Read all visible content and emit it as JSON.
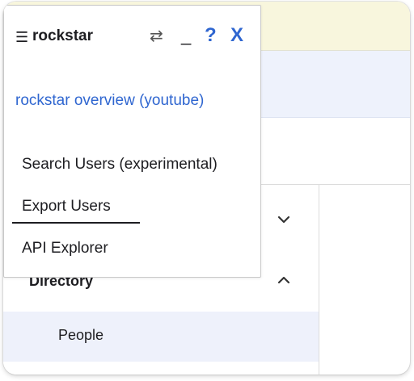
{
  "popup": {
    "menu_icon": "☰",
    "brand": "rockstar",
    "swap_icon": "⇄",
    "minimize_label": "_",
    "help_label": "?",
    "close_label": "X",
    "overview_link": "rockstar overview (youtube)",
    "menu_items": [
      "Search Users (experimental)",
      "Export Users",
      "API Explorer"
    ],
    "hovered_item_index": 1
  },
  "nav": {
    "collapsed_chevron": "chevron-down-icon",
    "expanded_chevron": "chevron-up-icon",
    "directory_label": "Directory",
    "people_label": "People"
  },
  "colors": {
    "link_blue": "#2f66d0",
    "banner_yellow": "#f8f6dd",
    "band_blue": "#eef2fc",
    "selected_row": "#eef1fb"
  }
}
